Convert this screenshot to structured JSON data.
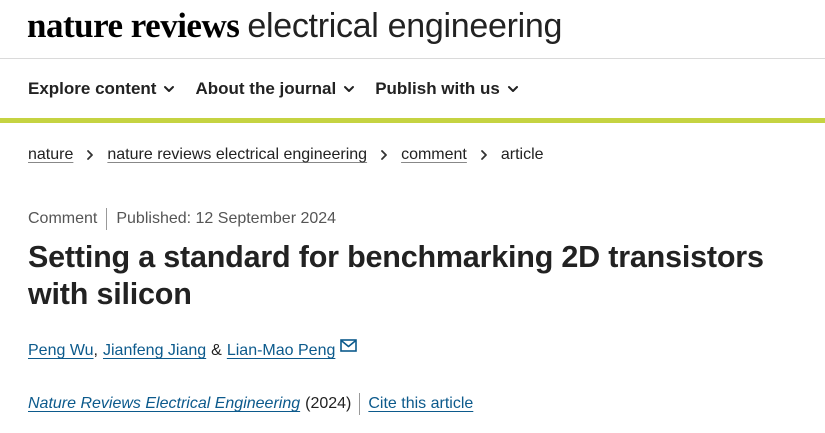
{
  "header": {
    "logo_brand": "nature reviews",
    "logo_journal": "electrical engineering",
    "nav": [
      {
        "label": "Explore content"
      },
      {
        "label": "About the journal"
      },
      {
        "label": "Publish with us"
      }
    ]
  },
  "breadcrumb": {
    "items": [
      {
        "label": "nature"
      },
      {
        "label": "nature reviews electrical engineering"
      },
      {
        "label": "comment"
      }
    ],
    "current": "article"
  },
  "article": {
    "type": "Comment",
    "published": "Published: 12 September 2024",
    "title": "Setting a standard for benchmarking 2D transistors with silicon",
    "authors": [
      {
        "name": "Peng Wu",
        "sep": ","
      },
      {
        "name": "Jianfeng Jiang",
        "sep": "&"
      },
      {
        "name": "Lian-Mao Peng"
      }
    ],
    "journal": "Nature Reviews Electrical Engineering",
    "year": "(2024)",
    "cite_label": "Cite this article"
  },
  "colors": {
    "accent_bar": "#c5d341",
    "link": "#0c5a8c",
    "text": "#222222"
  },
  "icons": [
    "chevron-down-icon",
    "chevron-right-icon",
    "mail-icon"
  ]
}
